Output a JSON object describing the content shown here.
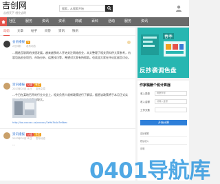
{
  "site": {
    "logo_text": "吉创网",
    "logo_subtitle": "吉创天下  创业吉时",
    "search_placeholder": "搜索，从搜索开始",
    "colors": {
      "accent": "#e5534b",
      "nav_bg": "#6a6a6a",
      "link": "#3a7bd5",
      "ad_bg": "#27b6b1",
      "watermark": "#1e90dc"
    }
  },
  "nav": {
    "items": [
      "社区",
      "服务",
      "资讯",
      "资讯",
      "商城",
      "百科",
      "活动",
      "服务",
      "资讯"
    ]
  },
  "subtabs": [
    "动态",
    "文章",
    "帖子",
    "问答",
    "资讯",
    "快讯"
  ],
  "posts": [
    {
      "author": "会员播报",
      "badge": "V",
      "time": "2分钟前",
      "source": "发布动态",
      "text": "…随着互联网的快速发展，越来越多的人开始关注网络创业，本文整理了相关资料供大家参考，内容包括创业项目、市场分析、运营技巧等，希望对大家有所帮助。也欢迎大家在评论区留言讨论。"
    },
    {
      "author": "资讯播报",
      "badge": "认证",
      "badge2": "专栏",
      "time": "2023年02月11日",
      "source": "发布文章",
      "text": "…今日在某地召开的行业大会上，相关负责人就新政策进行了解读，据悉该政策将于本月正式实施，对中小企业影响较大。",
      "link": "http://lao.xxxxxx.xx/xxxxxx/2e9d3b4a7e6bec"
    },
    {
      "author": "资讯播报",
      "badge": "认证",
      "badge2": "专栏",
      "time": "2023年02月11日",
      "source": "发布动态",
      "text": "…"
    }
  ],
  "ad": {
    "corner_text": "春季",
    "slogan": "反抄袭调色盘"
  },
  "calculator": {
    "title": "作家稿酬个税计算器",
    "rows": [
      {
        "label": "收入类型",
        "value": "稿酬所得"
      },
      {
        "label": "收入金额",
        "value": "请输入金额"
      },
      {
        "label": "工作天数",
        "value": ""
      }
    ],
    "button": "开始计算",
    "results": [
      "应纳税额",
      "税后收入",
      "说明"
    ]
  },
  "watermark": "0401导航库"
}
